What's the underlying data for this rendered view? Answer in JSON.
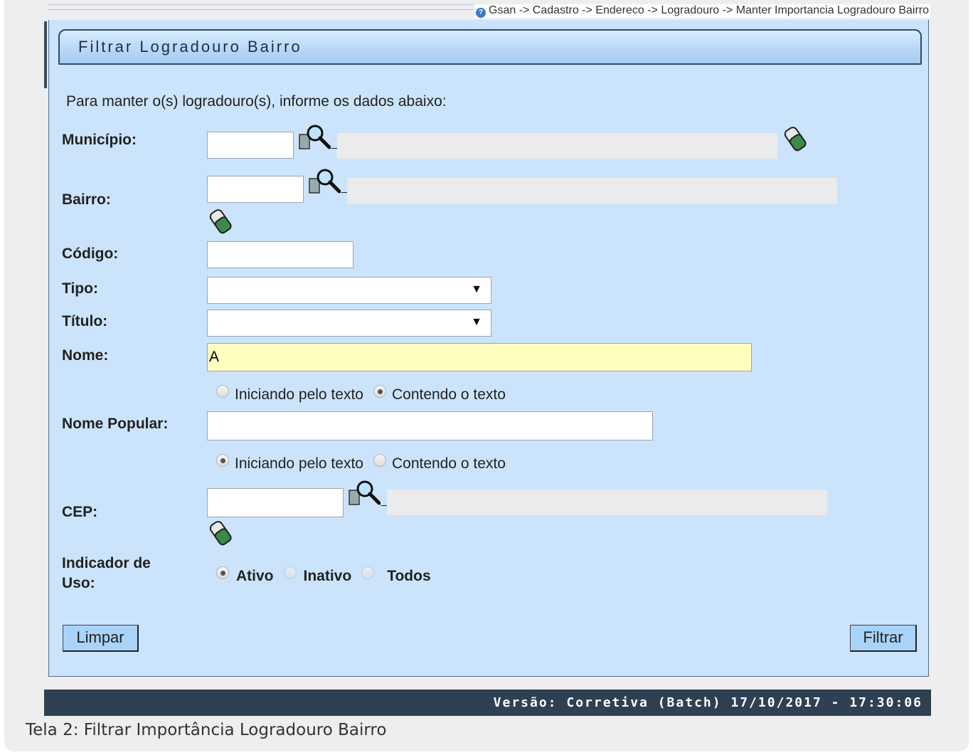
{
  "breadcrumb": "Gsan -> Cadastro -> Endereco -> Logradouro -> Manter Importancia Logradouro Bairro",
  "panel_title": "Filtrar Logradouro Bairro",
  "intro": "Para manter o(s) logradouro(s), informe os dados abaixo:",
  "labels": {
    "municipio": "Município:",
    "bairro": "Bairro:",
    "codigo": "Código:",
    "tipo": "Tipo:",
    "titulo": "Título:",
    "nome": "Nome:",
    "nome_popular": "Nome Popular:",
    "cep": "CEP:",
    "indicador_1": "Indicador de",
    "indicador_2": "Uso:"
  },
  "fields": {
    "municipio": "",
    "bairro": "",
    "codigo": "",
    "tipo": "",
    "titulo": "",
    "nome": "A",
    "nome_popular": "",
    "cep": ""
  },
  "options": {
    "iniciando": "Iniciando pelo texto",
    "contendo": "Contendo o texto",
    "ativo": "Ativo",
    "inativo": "Inativo",
    "todos": "Todos"
  },
  "selected": {
    "nome_match": "Contendo o texto",
    "nome_popular_match": "Iniciando pelo texto",
    "indicador_uso": "Ativo"
  },
  "buttons": {
    "limpar": "Limpar",
    "filtrar": "Filtrar"
  },
  "icons": {
    "lookup": "magnifier-icon",
    "clear": "eraser-icon",
    "help": "help-icon"
  },
  "colors": {
    "panel_bg": "#cce4fb",
    "highlight_field": "#ffffc0",
    "version_bar": "#2e4052"
  },
  "version": "Versão: Corretiva (Batch) 17/10/2017 - 17:30:06",
  "caption": "Tela 2: Filtrar Importância Logradouro Bairro"
}
